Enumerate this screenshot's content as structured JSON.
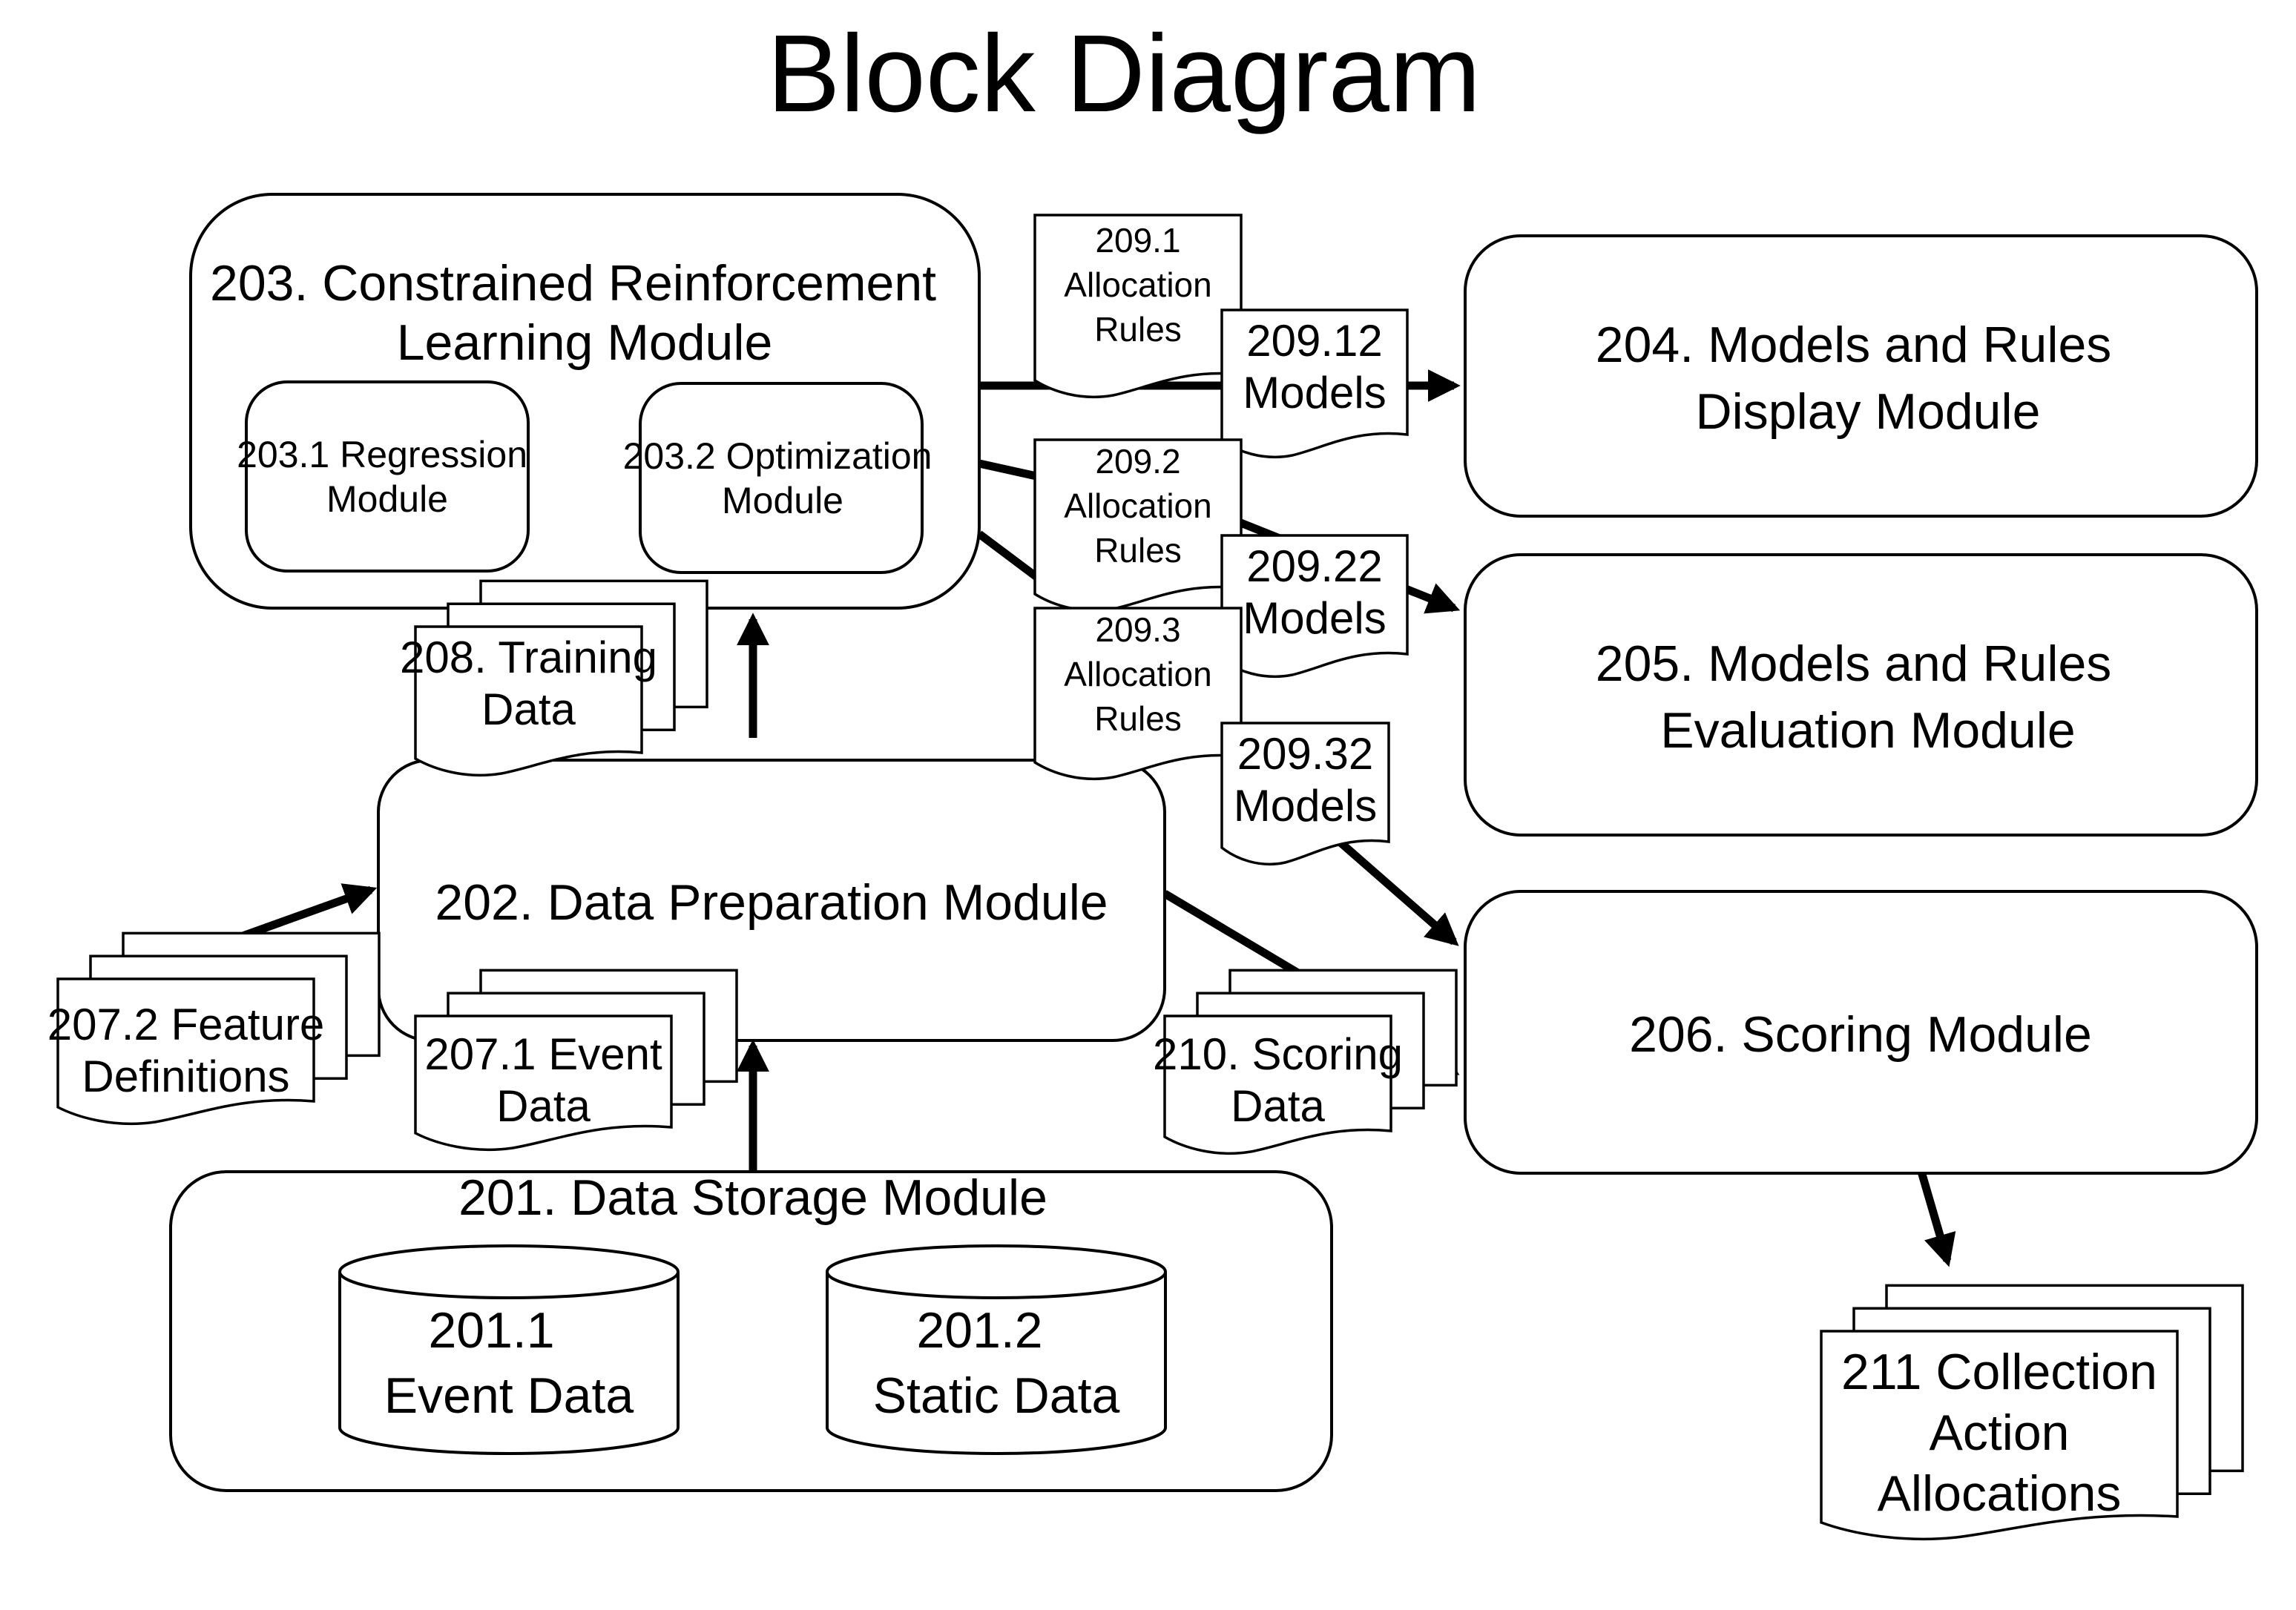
{
  "title": "Block Diagram",
  "modules": {
    "m201": {
      "lines": [
        "201. Data Storage Module"
      ]
    },
    "m201_1": {
      "lines": [
        "201.1",
        "Event Data"
      ]
    },
    "m201_2": {
      "lines": [
        "201.2",
        "Static Data"
      ]
    },
    "m202": {
      "lines": [
        "202. Data Preparation Module"
      ]
    },
    "m203": {
      "lines": [
        "203. Constrained Reinforcement",
        "Learning Module"
      ]
    },
    "m203_1": {
      "lines": [
        "203.1 Regression",
        "Module"
      ]
    },
    "m203_2": {
      "lines": [
        "203.2 Optimization",
        "Module"
      ]
    },
    "m204": {
      "lines": [
        "204. Models and Rules",
        "Display Module"
      ]
    },
    "m205": {
      "lines": [
        "205. Models and Rules",
        "Evaluation Module"
      ]
    },
    "m206": {
      "lines": [
        "206. Scoring Module"
      ]
    }
  },
  "documents": {
    "d207_1": {
      "lines": [
        "207.1 Event",
        "Data"
      ]
    },
    "d207_2": {
      "lines": [
        "207.2 Feature",
        "Definitions"
      ]
    },
    "d208": {
      "lines": [
        "208. Training",
        "Data"
      ]
    },
    "d209_1": {
      "lines": [
        "209.1",
        "Allocation",
        "Rules"
      ]
    },
    "d209_12": {
      "lines": [
        "209.12",
        "Models"
      ]
    },
    "d209_2": {
      "lines": [
        "209.2",
        "Allocation",
        "Rules"
      ]
    },
    "d209_22": {
      "lines": [
        "209.22",
        "Models"
      ]
    },
    "d209_3": {
      "lines": [
        "209.3",
        "Allocation",
        "Rules"
      ]
    },
    "d209_32": {
      "lines": [
        "209.32",
        "Models"
      ]
    },
    "d210": {
      "lines": [
        "210. Scoring",
        "Data"
      ]
    },
    "d211": {
      "lines": [
        "211 Collection",
        "Action",
        "Allocations"
      ]
    }
  },
  "connections": [
    {
      "from": "201. Data Storage Module",
      "to": "202. Data Preparation Module",
      "via": "207.1 Event Data"
    },
    {
      "from": "207.2 Feature Definitions",
      "to": "202. Data Preparation Module"
    },
    {
      "from": "202. Data Preparation Module",
      "to": "203. Constrained Reinforcement Learning Module",
      "via": "208. Training Data"
    },
    {
      "from": "203. Constrained Reinforcement Learning Module",
      "to": "204. Models and Rules Display Module",
      "via": "209.1 / 209.12"
    },
    {
      "from": "203. Constrained Reinforcement Learning Module",
      "to": "205. Models and Rules Evaluation Module",
      "via": "209.2 / 209.22"
    },
    {
      "from": "203. Constrained Reinforcement Learning Module",
      "to": "206. Scoring Module",
      "via": "209.3 / 209.32"
    },
    {
      "from": "202. Data Preparation Module",
      "to": "206. Scoring Module",
      "via": "210. Scoring Data"
    },
    {
      "from": "206. Scoring Module",
      "to": "211 Collection Action Allocations"
    }
  ]
}
